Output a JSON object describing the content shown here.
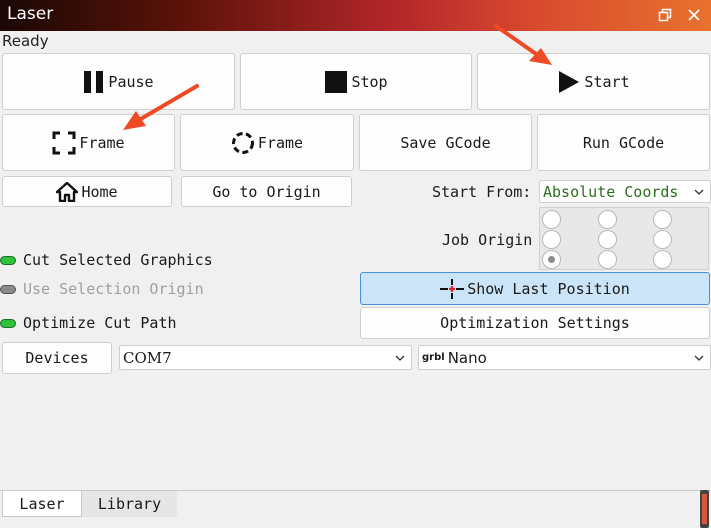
{
  "window": {
    "title": "Laser",
    "restore_icon": "restore-window-icon",
    "close_icon": "close-icon"
  },
  "status": "Ready",
  "controls": {
    "pause": "Pause",
    "stop": "Stop",
    "start": "Start"
  },
  "frame": {
    "rect": "Frame",
    "circle": "Frame",
    "save_gcode": "Save GCode",
    "run_gcode": "Run GCode"
  },
  "nav": {
    "home": "Home",
    "go_to_origin": "Go to Origin"
  },
  "start_from": {
    "label": "Start From:",
    "value": "Absolute Coords",
    "color": "#2a6f1e"
  },
  "job_origin": {
    "label": "Job Origin",
    "selected": "bottom-left"
  },
  "options": {
    "cut_selected": {
      "label": "Cut Selected Graphics",
      "enabled": true
    },
    "use_selection_origin": {
      "label": "Use Selection Origin",
      "enabled": false
    },
    "optimize_cut_path": {
      "label": "Optimize Cut Path",
      "enabled": true
    }
  },
  "show_last_position": "Show Last Position",
  "optimization_settings": "Optimization Settings",
  "devices": {
    "button": "Devices",
    "port": "COM7",
    "controller_logo": "grbl",
    "controller": "Nano"
  },
  "tabs": [
    "Laser",
    "Library"
  ],
  "colors": {
    "accent_arrow": "#ee4a26",
    "highlight_button": "#cce4f7",
    "toggle_on": "#2fc23a"
  }
}
